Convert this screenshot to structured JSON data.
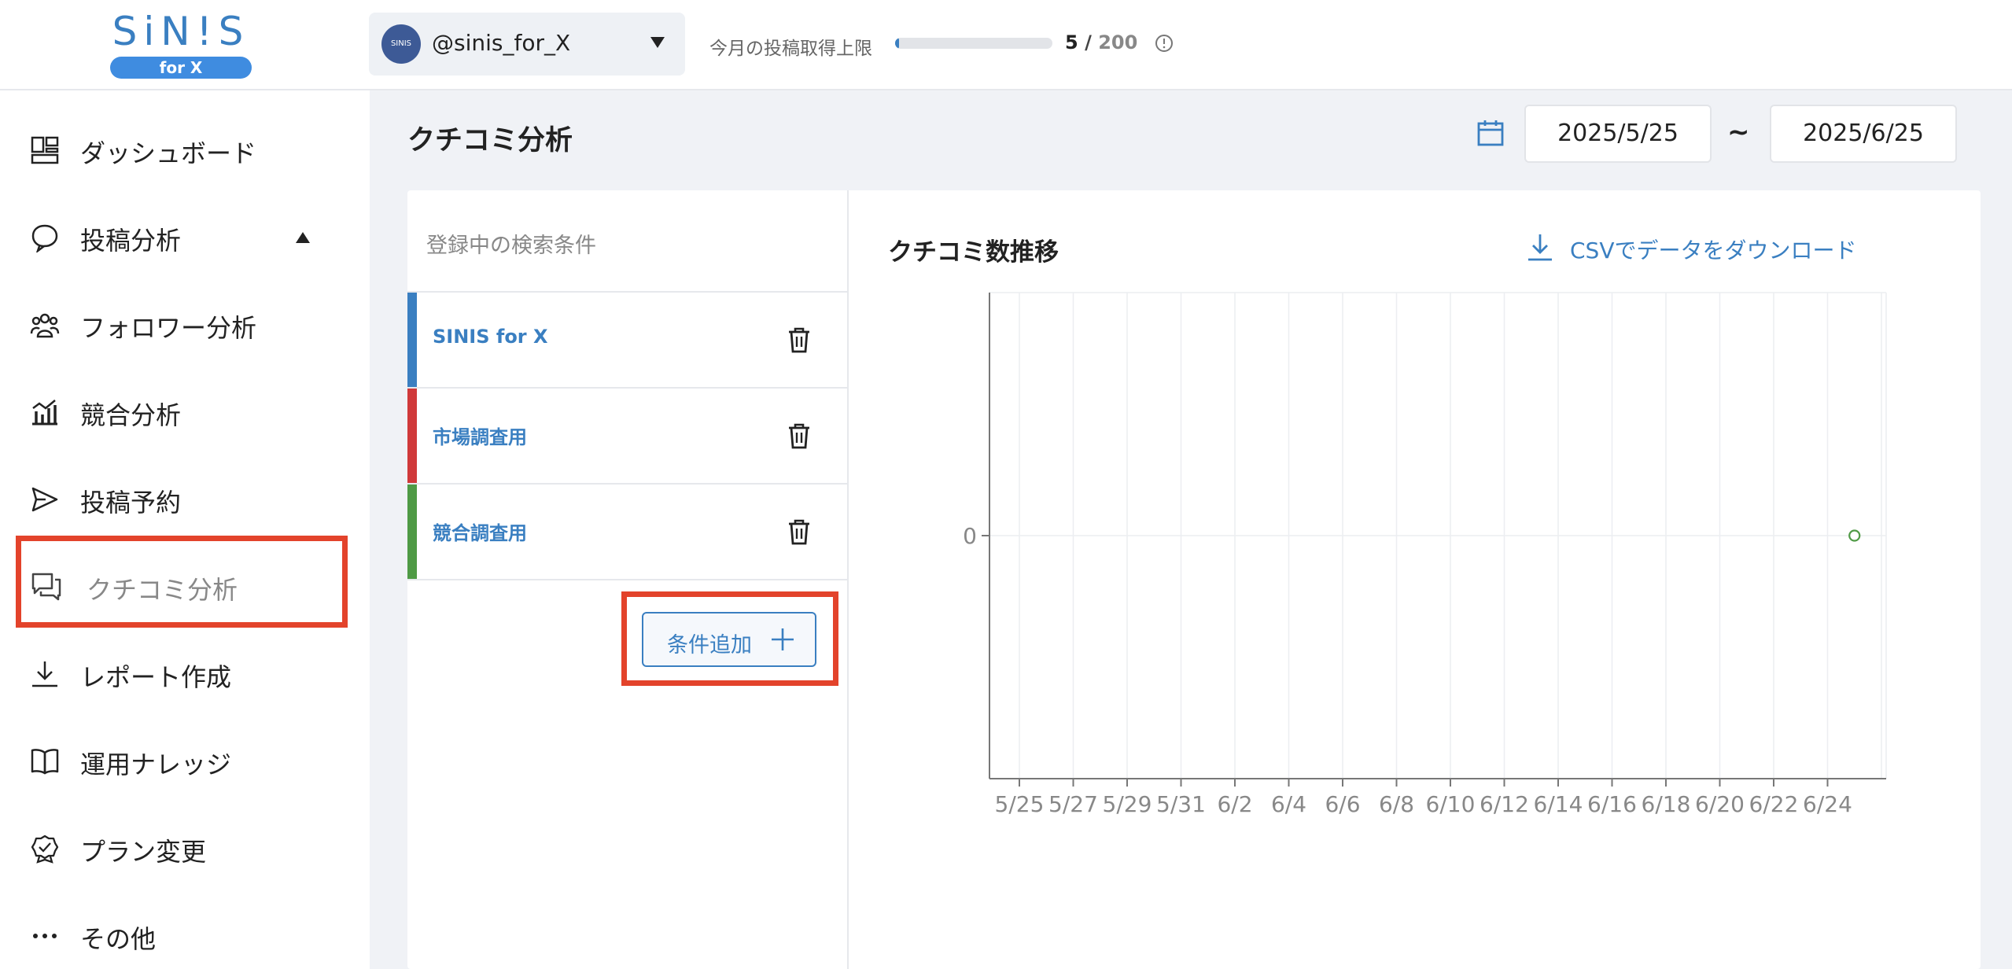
{
  "logo": {
    "name": "SiN!S",
    "sub": "for X"
  },
  "account": {
    "avatar_text": "SINIS",
    "handle": "@sinis_for_X"
  },
  "quota": {
    "label": "今月の投稿取得上限",
    "used": "5",
    "sep": "/",
    "max": "200",
    "fraction": 0.025
  },
  "sidebar": {
    "items": [
      {
        "label": "ダッシュボード",
        "icon": "dashboard-icon"
      },
      {
        "label": "投稿分析",
        "icon": "chat-bubble-icon"
      },
      {
        "label": "フォロワー分析",
        "icon": "followers-icon"
      },
      {
        "label": "競合分析",
        "icon": "bar-chart-icon"
      },
      {
        "label": "投稿予約",
        "icon": "send-icon"
      },
      {
        "label": "クチコミ分析",
        "icon": "chat-bubbles-icon"
      },
      {
        "label": "レポート作成",
        "icon": "download-icon"
      },
      {
        "label": "運用ナレッジ",
        "icon": "book-icon"
      },
      {
        "label": "プラン変更",
        "icon": "badge-icon"
      },
      {
        "label": "その他",
        "icon": "more-icon"
      }
    ],
    "active": "クチコミ分析"
  },
  "page": {
    "title": "クチコミ分析"
  },
  "date_range": {
    "start": "2025/5/25",
    "sep": "~",
    "end": "2025/6/25"
  },
  "conditions": {
    "header": "登録中の検索条件",
    "items": [
      {
        "name": "SINIS for X",
        "color": "#3a7fc1"
      },
      {
        "name": "市場調査用",
        "color": "#d0393a"
      },
      {
        "name": "競合調査用",
        "color": "#4f9a45"
      }
    ],
    "add_label": "条件追加"
  },
  "chart": {
    "title": "クチコミ数推移",
    "csv_label": "CSVでデータをダウンロード"
  },
  "chart_data": {
    "type": "line",
    "x": [
      "5/25",
      "5/27",
      "5/29",
      "5/31",
      "6/2",
      "6/4",
      "6/6",
      "6/8",
      "6/10",
      "6/12",
      "6/14",
      "6/16",
      "6/18",
      "6/20",
      "6/22",
      "6/24"
    ],
    "y_ticks": [
      "0"
    ],
    "series": [
      {
        "values": [
          0
        ],
        "point_x": "6/25",
        "color": "#4f9a45"
      }
    ],
    "grid": true
  }
}
